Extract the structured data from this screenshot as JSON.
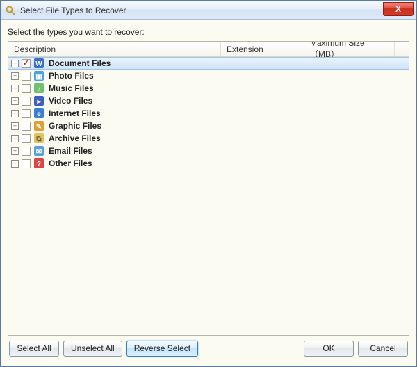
{
  "window": {
    "title": "Select File Types to Recover",
    "close_x": "X"
  },
  "instruction": "Select the types you want to recover:",
  "columns": {
    "description": "Description",
    "extension": "Extension",
    "max_size": "Maximum Size（MB）"
  },
  "file_types": [
    {
      "label": "Document Files",
      "checked": true,
      "selected": true,
      "icon": "document-icon"
    },
    {
      "label": "Photo Files",
      "checked": false,
      "selected": false,
      "icon": "photo-icon"
    },
    {
      "label": "Music Files",
      "checked": false,
      "selected": false,
      "icon": "music-icon"
    },
    {
      "label": "Video Files",
      "checked": false,
      "selected": false,
      "icon": "video-icon"
    },
    {
      "label": "Internet Files",
      "checked": false,
      "selected": false,
      "icon": "internet-icon"
    },
    {
      "label": "Graphic Files",
      "checked": false,
      "selected": false,
      "icon": "graphic-icon"
    },
    {
      "label": "Archive Files",
      "checked": false,
      "selected": false,
      "icon": "archive-icon"
    },
    {
      "label": "Email Files",
      "checked": false,
      "selected": false,
      "icon": "email-icon"
    },
    {
      "label": "Other Files",
      "checked": false,
      "selected": false,
      "icon": "other-icon"
    }
  ],
  "buttons": {
    "select_all": "Select All",
    "unselect_all": "Unselect All",
    "reverse_select": "Reverse Select",
    "ok": "OK",
    "cancel": "Cancel"
  },
  "icons": {
    "document-icon": {
      "bg": "#3b6fc9",
      "fg": "#fff",
      "glyph": "W"
    },
    "photo-icon": {
      "bg": "#4aa3df",
      "fg": "#fff",
      "glyph": "▣"
    },
    "music-icon": {
      "bg": "#6ec16e",
      "fg": "#fff",
      "glyph": "♪"
    },
    "video-icon": {
      "bg": "#4060c0",
      "fg": "#fff",
      "glyph": "▸"
    },
    "internet-icon": {
      "bg": "#3a7fd5",
      "fg": "#fff",
      "glyph": "e"
    },
    "graphic-icon": {
      "bg": "#e0a030",
      "fg": "#fff",
      "glyph": "✎"
    },
    "archive-icon": {
      "bg": "#e6c258",
      "fg": "#555",
      "glyph": "⧉"
    },
    "email-icon": {
      "bg": "#5aa0e0",
      "fg": "#fff",
      "glyph": "✉"
    },
    "other-icon": {
      "bg": "#d44",
      "fg": "#fff",
      "glyph": "?"
    },
    "app-icon": {
      "bg": "#e6b84a",
      "fg": "#8b5",
      "glyph": "🔍"
    }
  }
}
